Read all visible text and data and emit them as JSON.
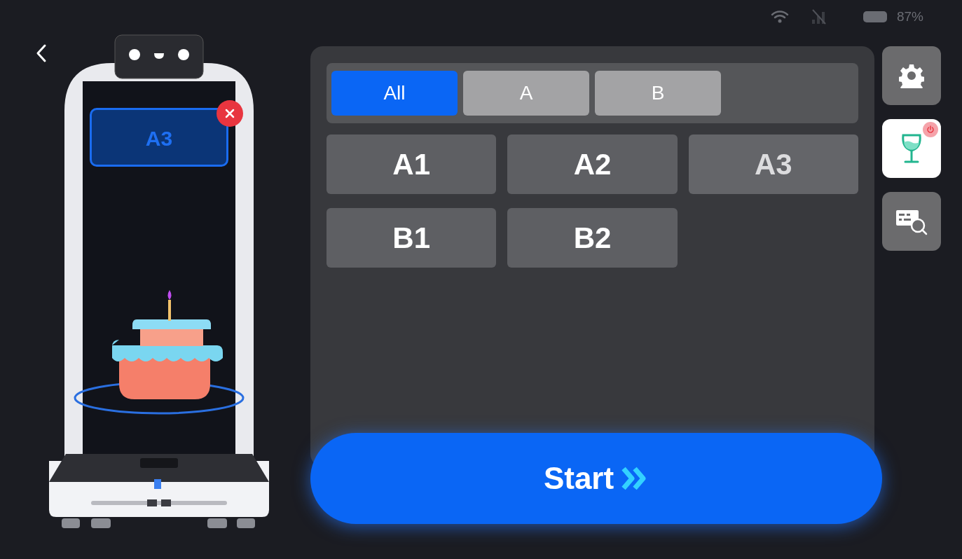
{
  "status_bar": {
    "battery": "87%"
  },
  "robot_bubble": {
    "label": "A3"
  },
  "tabs": [
    {
      "label": "All",
      "selected": true
    },
    {
      "label": "A",
      "selected": false
    },
    {
      "label": "B",
      "selected": false
    }
  ],
  "tables": [
    {
      "label": "A1",
      "selected": false
    },
    {
      "label": "A2",
      "selected": false
    },
    {
      "label": "A3",
      "selected": true
    },
    {
      "label": "B1",
      "selected": false
    },
    {
      "label": "B2",
      "selected": false
    }
  ],
  "start_button": {
    "label": "Start"
  },
  "side_buttons": [
    {
      "kind": "settings"
    },
    {
      "kind": "drink"
    },
    {
      "kind": "table-search"
    }
  ]
}
